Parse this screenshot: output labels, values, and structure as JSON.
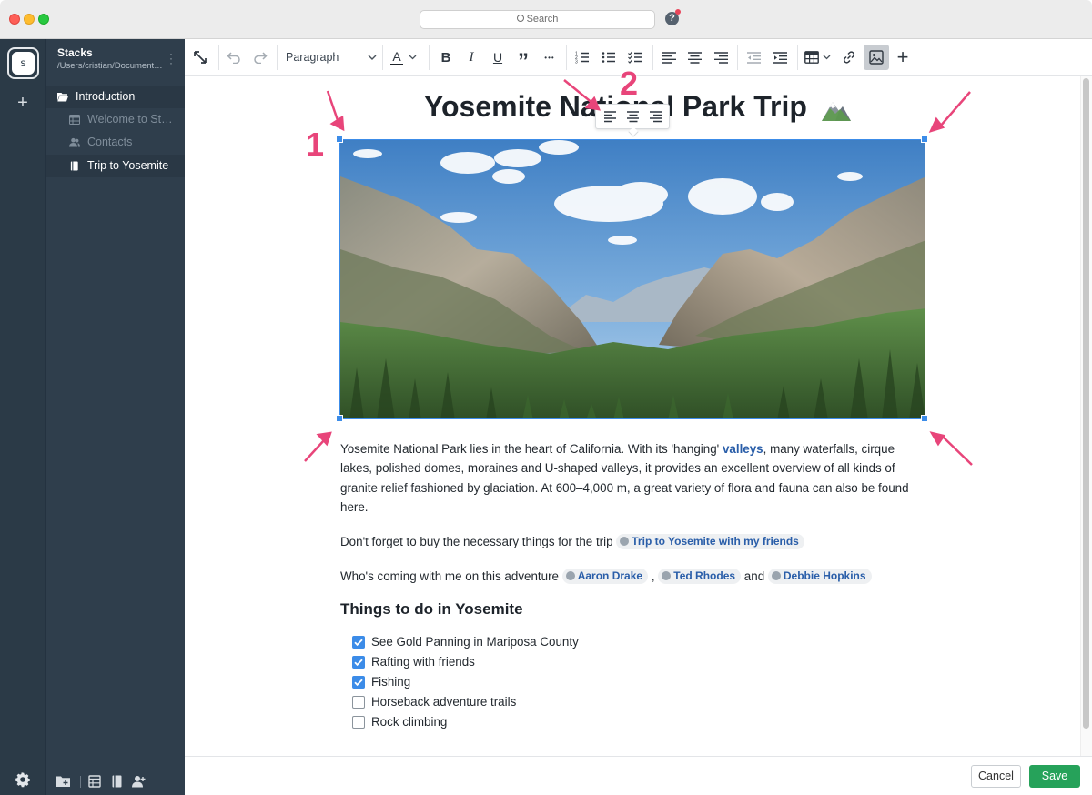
{
  "titlebar": {
    "search_placeholder": "Search",
    "help_label": "?"
  },
  "rail": {
    "stack_initial": "s",
    "add_label": "+"
  },
  "sidebar": {
    "title": "Stacks",
    "path": "/Users/cristian/Documents/Stacks",
    "items": [
      {
        "label": "Introduction",
        "icon": "folder-open-icon"
      },
      {
        "label": "Welcome to Stacks",
        "icon": "table-icon"
      },
      {
        "label": "Contacts",
        "icon": "contacts-icon"
      },
      {
        "label": "Trip to Yosemite",
        "icon": "notebook-icon"
      }
    ]
  },
  "toolbar": {
    "paragraph_style": "Paragraph",
    "font_color_label": "A",
    "bold_label": "B",
    "italic_label": "I",
    "underline_label": "U",
    "quote_label": "”",
    "more_label": "•••",
    "add_label": "+"
  },
  "document": {
    "title": "Yosemite National Park Trip",
    "paragraph1_a": "Yosemite National Park lies in the heart of California. With its 'hanging' ",
    "paragraph1_link": "valleys",
    "paragraph1_b": ", many waterfalls, cirque lakes, polished domes, moraines and U-shaped valleys, it provides an excellent overview of all kinds of granite relief fashioned by glaciation. At 600–4,000 m, a great variety of flora and fauna can also be found here.",
    "paragraph2": "Don't forget to buy the necessary things for the trip ",
    "paragraph2_chip": "Trip to Yosemite with my friends",
    "paragraph3": "Who's coming with me on this adventure ",
    "person1": "Aaron Drake",
    "sep1": ",",
    "person2": "Ted Rhodes",
    "sep2": "and",
    "person3": "Debbie Hopkins",
    "heading": "Things to do in Yosemite",
    "todos": [
      {
        "label": "See Gold Panning in Mariposa County",
        "checked": true
      },
      {
        "label": "Rafting with friends",
        "checked": true
      },
      {
        "label": "Fishing",
        "checked": true
      },
      {
        "label": "Horseback adventure trails",
        "checked": false
      },
      {
        "label": "Rock climbing",
        "checked": false
      }
    ]
  },
  "annotations": {
    "label1": "1",
    "label2": "2"
  },
  "footer": {
    "cancel_label": "Cancel",
    "save_label": "Save"
  },
  "colors": {
    "accent": "#3c8ce8",
    "save": "#26a25a",
    "sidebar": "#2f3e4c",
    "annotation": "#e8457a"
  }
}
